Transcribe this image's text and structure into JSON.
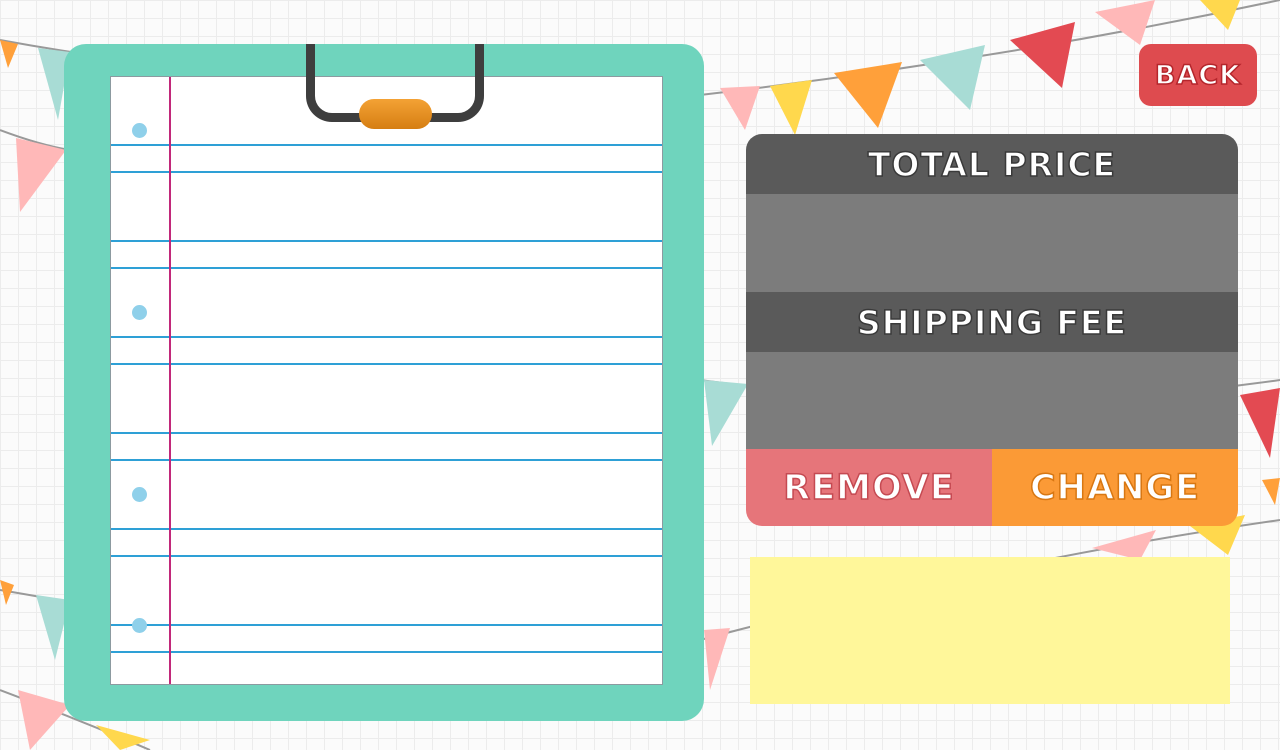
{
  "buttons": {
    "back": "BACK",
    "remove": "REMOVE",
    "change": "CHANGE"
  },
  "panel": {
    "total_price_label": "TOTAL PRICE",
    "total_price_value": "",
    "shipping_fee_label": "SHIPPING FEE",
    "shipping_fee_value": ""
  },
  "colors": {
    "clipboard": "#6fd4bd",
    "back_button": "#de4b4f",
    "panel_header": "#5a5a5a",
    "panel_body": "#7c7c7c",
    "remove_button": "#e6757a",
    "change_button": "#fb9a36",
    "sticky_note": "#fff79a",
    "paper_rule": "#2ea0d6",
    "paper_margin": "#c2287a"
  },
  "icons": {
    "clipboard_clip": "clip-icon",
    "bunting": "bunting-decoration"
  }
}
